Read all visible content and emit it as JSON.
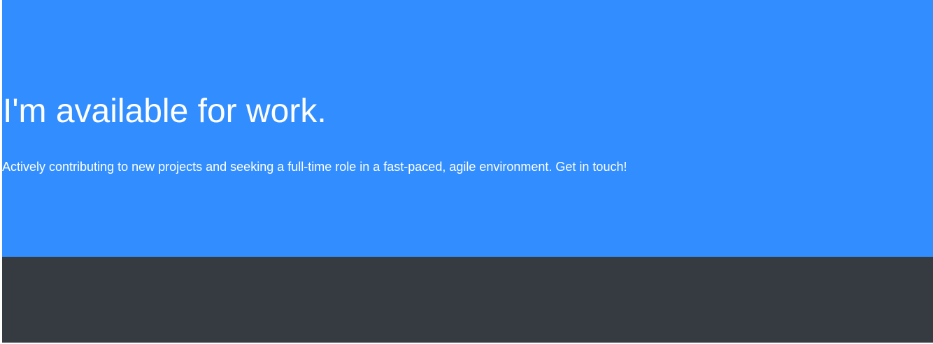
{
  "hero": {
    "heading": "I'm available for work.",
    "subtext": "Actively contributing to new projects and seeking a full-time role in a fast-paced, agile environment. Get in touch!",
    "background_color": "#328eff",
    "text_color": "#ffffff"
  },
  "footer": {
    "background_color": "#363a41"
  }
}
